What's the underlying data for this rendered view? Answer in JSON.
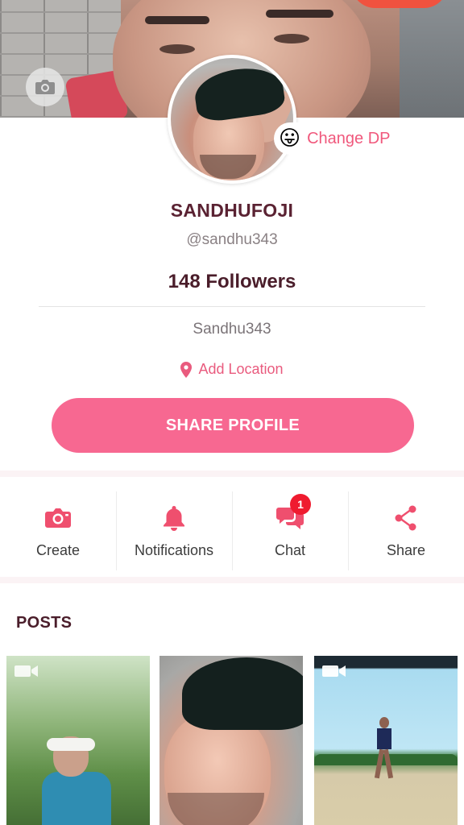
{
  "profile": {
    "display_name": "SANDHUFOJI",
    "handle": "@sandhu343",
    "followers": "148 Followers",
    "bio": "Sandhu343",
    "add_location": "Add Location",
    "change_dp": "Change DP",
    "change_dp_emoji": "😛",
    "share_profile": "SHARE PROFILE"
  },
  "actions": [
    {
      "label": "Create",
      "icon": "camera-icon"
    },
    {
      "label": "Notifications",
      "icon": "bell-icon"
    },
    {
      "label": "Chat",
      "icon": "chat-icon",
      "badge": "1"
    },
    {
      "label": "Share",
      "icon": "share-icon"
    }
  ],
  "posts": {
    "title": "POSTS"
  },
  "colors": {
    "accent": "#f76891",
    "accent_text": "#e95b7e",
    "icon": "#ef4f6e",
    "title": "#4a1d2a",
    "badge": "#ef1b2f"
  }
}
